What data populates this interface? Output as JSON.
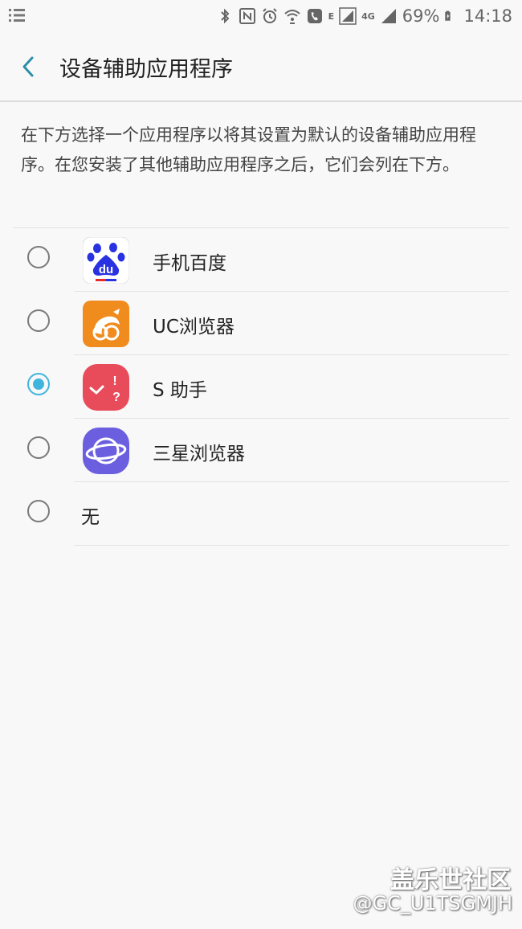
{
  "status_bar": {
    "menu_icon": "notification-list-icon",
    "icons": [
      "bluetooth-icon",
      "nfc-icon",
      "alarm-icon",
      "wifi-calling-icon",
      "call-icon",
      "e-signal-icon",
      "4g-signal-icon"
    ],
    "network_e": "E",
    "network_4g": "4G",
    "battery_percent": "69%",
    "time": "14:18"
  },
  "header": {
    "back_icon": "chevron-left-icon",
    "title": "设备辅助应用程序"
  },
  "description": "在下方选择一个应用程序以将其设置为默认的设备辅助应用程序。在您安装了其他辅助应用程序之后，它们会列在下方。",
  "options": [
    {
      "label": "手机百度",
      "icon": "baidu-icon",
      "selected": false
    },
    {
      "label": "UC浏览器",
      "icon": "uc-browser-icon",
      "selected": false
    },
    {
      "label": "S 助手",
      "icon": "s-assistant-icon",
      "selected": true
    },
    {
      "label": "三星浏览器",
      "icon": "samsung-internet-icon",
      "selected": false
    },
    {
      "label": "无",
      "icon": null,
      "selected": false
    }
  ],
  "watermark": {
    "line1": "盖乐世社区",
    "line2": "@GC_U1TSGMJH"
  },
  "colors": {
    "accent": "#3fb5de",
    "background": "#f8f8f8",
    "baidu_blue": "#2932e1",
    "uc_orange": "#f08b1e",
    "s_assistant_red": "#e84c5b",
    "samsung_internet_purple": "#6b5fe0"
  }
}
